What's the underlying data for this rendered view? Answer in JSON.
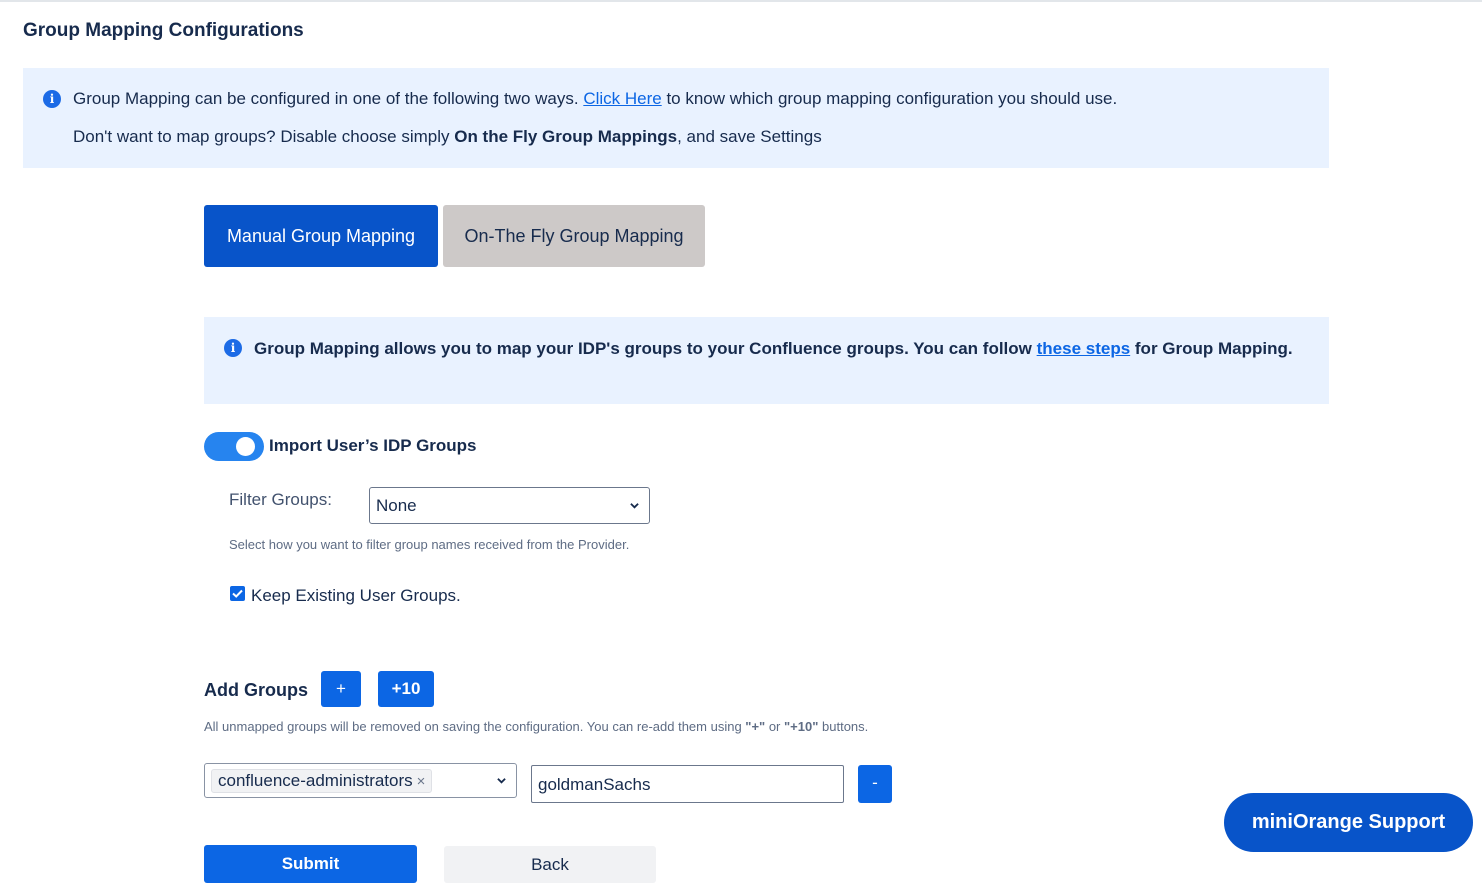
{
  "page": {
    "title": "Group Mapping Configurations"
  },
  "top_info": {
    "line1_pre": "Group Mapping can be configured in one of the following two ways. ",
    "line1_link": "Click Here",
    "line1_post": " to know which group mapping configuration you should use.",
    "line2_pre": "Don't want to map groups? Disable choose simply ",
    "line2_bold": "On the Fly Group Mappings",
    "line2_post": ", and save Settings"
  },
  "tabs": [
    {
      "label": "Manual Group Mapping",
      "active": true
    },
    {
      "label": "On-The Fly Group Mapping",
      "active": false
    }
  ],
  "mid_info": {
    "text_pre": "Group Mapping allows you to map your IDP's groups to your Confluence groups. You can follow ",
    "link": "these steps",
    "text_post": " for Group Mapping."
  },
  "import_toggle": {
    "label": "Import User’s IDP Groups",
    "on": true
  },
  "filter": {
    "label": "Filter Groups:",
    "selected": "None",
    "help": "Select how you want to filter group names received from the Provider."
  },
  "keep_existing": {
    "label": "Keep Existing User Groups.",
    "checked": true
  },
  "add_groups": {
    "label": "Add Groups",
    "plus_label": "+",
    "plus10_label": "+10",
    "help_pre": "All unmapped groups will be removed on saving the configuration. You can re-add them using ",
    "help_q1": "\"+\"",
    "help_mid": " or ",
    "help_q2": "\"+10\"",
    "help_post": " buttons."
  },
  "mapping_row": {
    "confluence_group": "confluence-administrators",
    "remove_tag_glyph": "×",
    "idp_group": "goldmanSachs",
    "minus_label": "-"
  },
  "actions": {
    "submit_label": "Submit",
    "back_label": "Back"
  },
  "support": {
    "label": "miniOrange Support"
  },
  "colors": {
    "primary": "#0c66e4",
    "tab_active": "#0854c9",
    "tab_inactive": "#cdc9c8",
    "info_bg": "#e9f2ff",
    "toggle": "#2684ef"
  },
  "icons": {
    "info": "info-icon",
    "dropdown": "chevron-down-icon",
    "check": "check-icon"
  }
}
